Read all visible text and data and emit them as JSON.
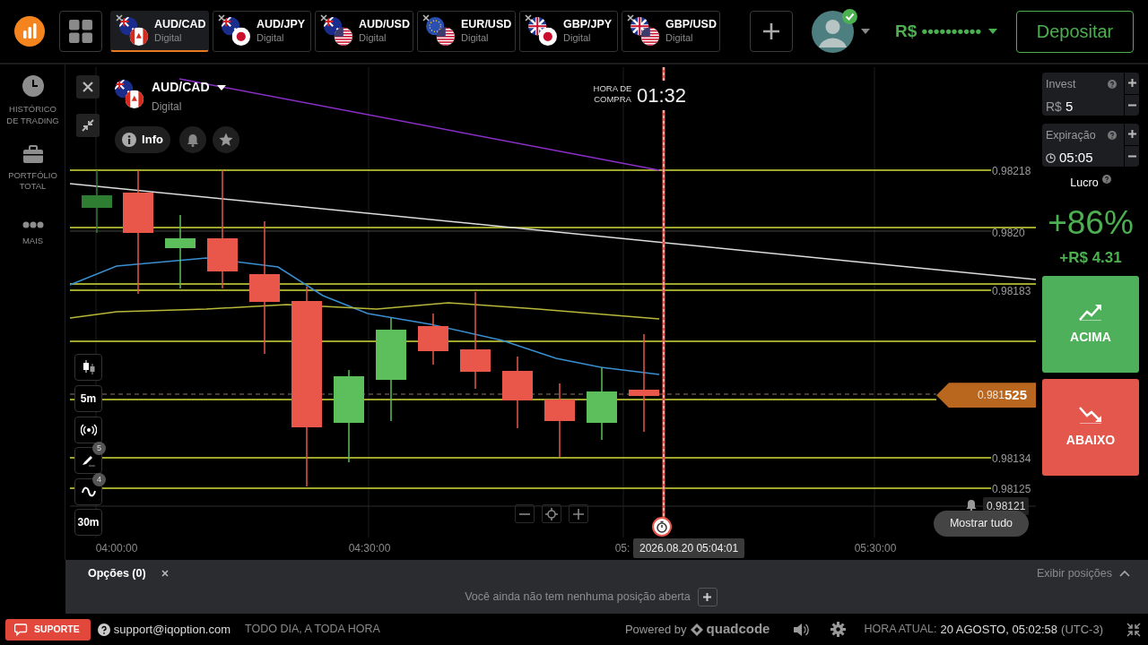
{
  "top_bar": {
    "tabs": [
      {
        "pair": "AUD/CAD",
        "type": "Digital",
        "selected": true
      },
      {
        "pair": "AUD/JPY",
        "type": "Digital",
        "selected": false
      },
      {
        "pair": "AUD/USD",
        "type": "Digital",
        "selected": false
      },
      {
        "pair": "EUR/USD",
        "type": "Digital",
        "selected": false
      },
      {
        "pair": "GBP/JPY",
        "type": "Digital",
        "selected": false
      },
      {
        "pair": "GBP/USD",
        "type": "Digital",
        "selected": false
      }
    ],
    "avatar": {
      "verified": true
    },
    "balance": "R$ ••••••••••",
    "deposit_button": "Depositar"
  },
  "sidebar": {
    "items": [
      {
        "kind": "clock",
        "label": "HISTÓRICO DE TRADING"
      },
      {
        "kind": "briefcase",
        "label": "PORTFÓLIO TOTAL"
      },
      {
        "kind": "more",
        "label": "MAIS"
      }
    ]
  },
  "chart": {
    "asset": {
      "pair": "AUD/CAD",
      "type": "Digital"
    },
    "info_button": "Info",
    "purchase_time": {
      "label": "HORA DE COMPRA",
      "timer": "01:32"
    },
    "tools": [
      {
        "kind": "chart-type"
      },
      {
        "kind": "label",
        "label": "5m"
      },
      {
        "kind": "signals"
      },
      {
        "kind": "drawing",
        "badge": "5"
      },
      {
        "kind": "indicators",
        "badge": "4"
      },
      {
        "kind": "label",
        "label": "30m"
      }
    ],
    "price_labels": [
      "0.98218",
      "0.9820",
      "0.98183",
      "0.98134",
      "0.98125"
    ],
    "current_price": "0.981**525**",
    "alert_price": "0.98121",
    "time_labels": [
      "04:00:00",
      "04:30:00",
      "05:",
      "05:30:00"
    ],
    "cursor_time": "2026.08.20 05:04:01",
    "show_all_button": "Mostrar tudo"
  },
  "trade_panel": {
    "invest": {
      "label": "Invest",
      "currency": "R$",
      "value": "5"
    },
    "expiration": {
      "label": "Expiração",
      "value": "05:05"
    },
    "profit": {
      "label": "Lucro",
      "percent": "+86%",
      "amount": "+R$ 4.31"
    },
    "buttons": [
      {
        "kind": "up",
        "label": "ACIMA"
      },
      {
        "kind": "down",
        "label": "ABAIXO"
      }
    ]
  },
  "positions_panel": {
    "tab": "Opções (0)",
    "toggle": "Exibir posições",
    "empty_message": "Você ainda não tem nenhuma posição aberta"
  },
  "footer": {
    "support_button": "SUPORTE",
    "email": "support@iqoption.com",
    "hours": "TODO DIA, A TODA HORA",
    "powered_by": "Powered by",
    "brand": "quadcode",
    "clock_label": "HORA ATUAL:",
    "clock_value": "20 AGOSTO, 05:02:58",
    "timezone": "(UTC-3)"
  }
}
